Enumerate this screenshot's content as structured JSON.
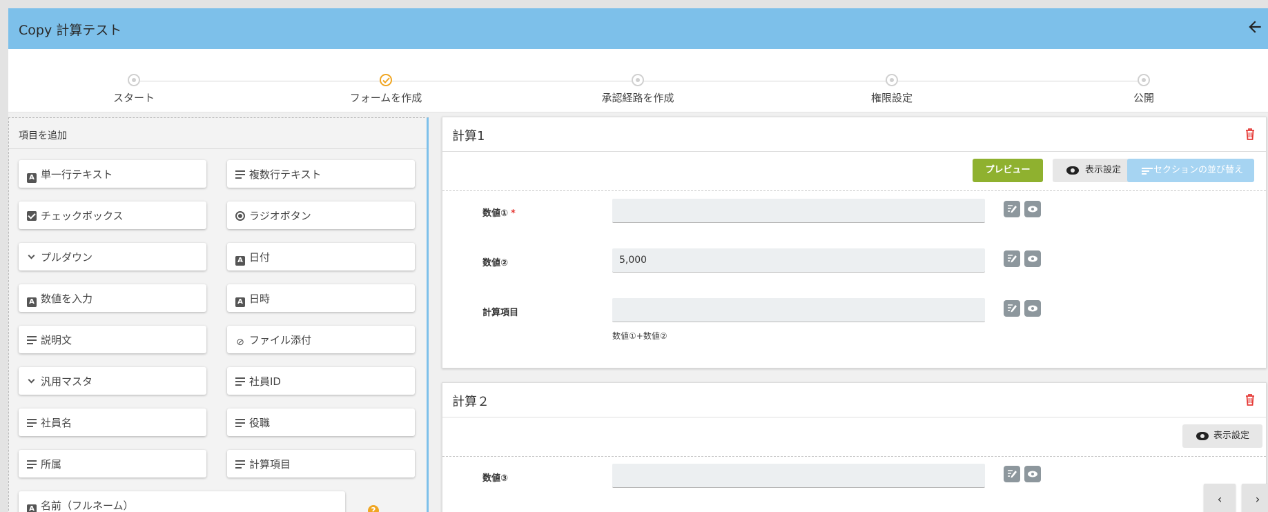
{
  "header": {
    "title": "Copy 計算テスト"
  },
  "stepper": {
    "steps": [
      {
        "label": "スタート"
      },
      {
        "label": "フォームを作成"
      },
      {
        "label": "承認経路を作成"
      },
      {
        "label": "権限設定"
      },
      {
        "label": "公開"
      }
    ],
    "active_step": 2
  },
  "palette": {
    "title": "項目を追加",
    "items": [
      {
        "label": "単一行テキスト",
        "icon": "text-box-icon"
      },
      {
        "label": "複数行テキスト",
        "icon": "multiline-icon"
      },
      {
        "label": "チェックボックス",
        "icon": "checkbox-icon"
      },
      {
        "label": "ラジオボタン",
        "icon": "radio-icon"
      },
      {
        "label": "プルダウン",
        "icon": "chevron-down-icon"
      },
      {
        "label": "日付",
        "icon": "text-box-icon"
      },
      {
        "label": "数値を入力",
        "icon": "text-box-icon"
      },
      {
        "label": "日時",
        "icon": "text-box-icon"
      },
      {
        "label": "説明文",
        "icon": "multiline-icon"
      },
      {
        "label": "ファイル添付",
        "icon": "paperclip-icon"
      },
      {
        "label": "汎用マスタ",
        "icon": "chevron-down-icon"
      },
      {
        "label": "社員ID",
        "icon": "multiline-icon"
      },
      {
        "label": "社員名",
        "icon": "multiline-icon"
      },
      {
        "label": "役職",
        "icon": "multiline-icon"
      },
      {
        "label": "所属",
        "icon": "multiline-icon"
      },
      {
        "label": "計算項目",
        "icon": "multiline-icon"
      },
      {
        "label": "名前（フルネーム）",
        "icon": "text-box-icon"
      }
    ]
  },
  "sections": [
    {
      "title": "計算1",
      "buttons": {
        "preview": "プレビュー",
        "display": "表示設定",
        "sort": "セクションの並び替え"
      },
      "fields": [
        {
          "label": "数値①",
          "required_mark": "*",
          "value": "",
          "note": ""
        },
        {
          "label": "数値②",
          "required_mark": "",
          "value": "5,000",
          "note": ""
        },
        {
          "label": "計算項目",
          "required_mark": "",
          "value": "",
          "note": "数値①+数値②"
        }
      ]
    },
    {
      "title": "計算２",
      "buttons": {
        "display": "表示設定"
      },
      "fields": [
        {
          "label": "数値③",
          "required_mark": "",
          "value": "",
          "note": ""
        }
      ]
    }
  ],
  "pager": {
    "prev": "‹",
    "next": "›"
  },
  "colors": {
    "header": "#7dc0ea",
    "accent": "#f0a623",
    "preview": "#8fb12f",
    "danger": "#e53935"
  }
}
